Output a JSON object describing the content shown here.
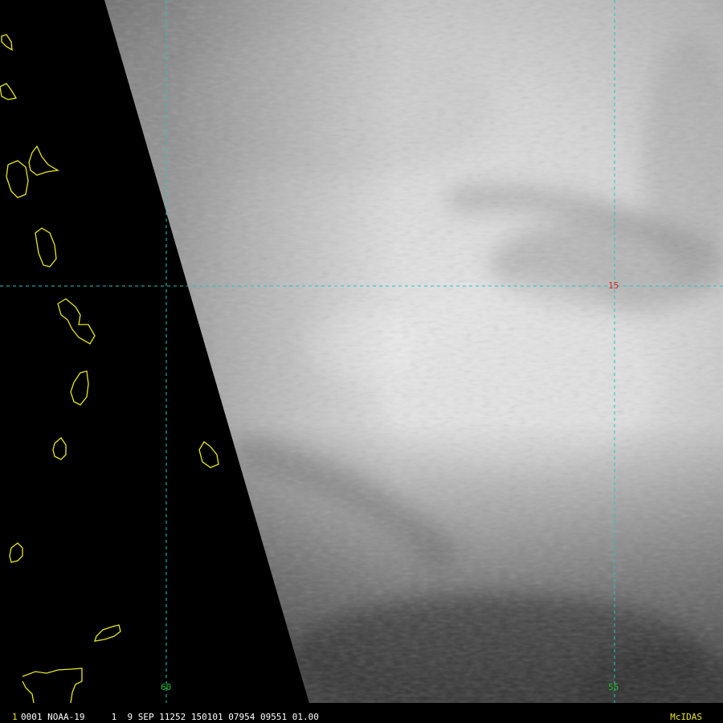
{
  "colors": {
    "background": "#000000",
    "coastline": "#e6e61e",
    "gridline": "#1ec8c8",
    "latitude_label": "#e02020",
    "longitude_label": "#20c020",
    "frame_number": "#e6e61e",
    "status_text": "#ffffff",
    "brand": "#e6e61e"
  },
  "grid": {
    "latitude_label": "15",
    "longitude_labels": [
      "60",
      "55"
    ]
  },
  "status_bar": {
    "frame_number": "1",
    "text": "0001 NOAA-19     1  9 SEP 11252 150101 07954 09551 01.00",
    "brand": "McIDAS"
  }
}
